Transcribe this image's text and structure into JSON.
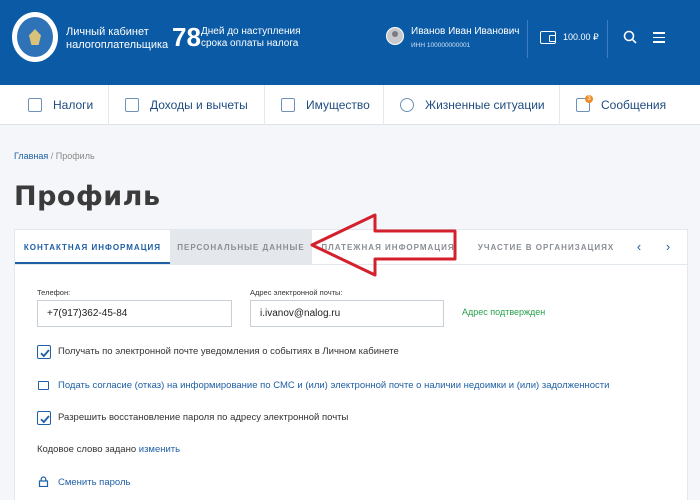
{
  "header": {
    "brand_line1": "Личный кабинет",
    "brand_line2": "налогоплательщика",
    "days_count": "78",
    "days_label_line1": "Дней до наступления",
    "days_label_line2": "срока оплаты налога",
    "user_name": "Иванов Иван Иванович",
    "user_inn": "ИНН 100000000001",
    "balance": "100.00 ₽"
  },
  "nav": {
    "items": [
      {
        "label": "Налоги",
        "icon": "taxes-icon"
      },
      {
        "label": "Доходы и вычеты",
        "icon": "income-icon"
      },
      {
        "label": "Имущество",
        "icon": "property-icon"
      },
      {
        "label": "Жизненные ситуации",
        "icon": "life-situations-icon"
      },
      {
        "label": "Сообщения",
        "icon": "messages-icon"
      }
    ],
    "messages_badge": "3"
  },
  "breadcrumb": {
    "home": "Главная",
    "separator": " / ",
    "current": "Профиль"
  },
  "page_title": "Профиль",
  "tabs": {
    "items": [
      {
        "label": "КОНТАКТНАЯ ИНФОРМАЦИЯ",
        "state": "active"
      },
      {
        "label": "ПЕРСОНАЛЬНЫЕ ДАННЫЕ",
        "state": "hover"
      },
      {
        "label": "ПЛАТЕЖНАЯ ИНФОРМАЦИЯ",
        "state": "normal"
      },
      {
        "label": "УЧАСТИЕ В ОРГАНИЗАЦИЯХ",
        "state": "normal"
      }
    ]
  },
  "contact": {
    "phone_label": "Телефон:",
    "phone_value": "+7(917)362-45-84",
    "email_label": "Адрес электронной почты:",
    "email_value": "i.ivanov@nalog.ru",
    "email_status": "Адрес подтвержден",
    "notify_label": "Получать по электронной почте уведомления о событиях в Личном кабинете",
    "consent_link": "Подать согласие (отказ) на информирование по СМС и (или) электронной почте о наличии недоимки и (или) задолженности",
    "restore_label": "Разрешить восстановление пароля по адресу электронной почты",
    "codeword_text": "Кодовое слово задано",
    "codeword_link": "изменить",
    "change_password_link": "Сменить пароль"
  },
  "colors": {
    "header_bg": "#0a5aa5",
    "link": "#1f5fa4",
    "verified": "#27a14b",
    "annotation_arrow": "#d4202c"
  }
}
